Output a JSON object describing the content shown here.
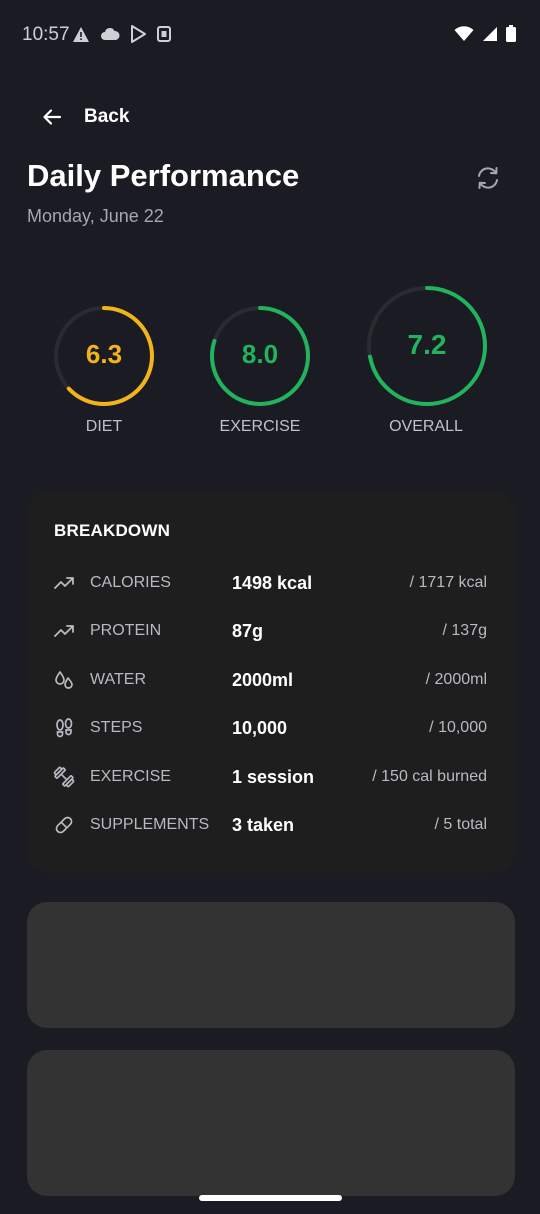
{
  "status_bar": {
    "time": "10:57",
    "left_icons": [
      "warning-icon",
      "cloud-icon",
      "play-store-icon",
      "notification-icon"
    ],
    "right_icons": [
      "wifi-icon",
      "signal-icon",
      "battery-icon"
    ]
  },
  "header": {
    "back_label": "Back",
    "title": "Daily Performance",
    "date": "Monday, June 22"
  },
  "scores": [
    {
      "label": "DIET",
      "value": "6.3",
      "score": 6.3,
      "max": 10,
      "color": "#f2b418"
    },
    {
      "label": "EXERCISE",
      "value": "8.0",
      "score": 8.0,
      "max": 10,
      "color": "#22b35c"
    },
    {
      "label": "OVERALL",
      "value": "7.2",
      "score": 7.2,
      "max": 10,
      "color": "#22b35c"
    }
  ],
  "breakdown": {
    "title": "BREAKDOWN",
    "rows": [
      {
        "icon": "trending-up-icon",
        "label": "CALORIES",
        "value": "1498 kcal",
        "target": "/ 1717 kcal"
      },
      {
        "icon": "trending-up-icon",
        "label": "PROTEIN",
        "value": "87g",
        "target": "/ 137g"
      },
      {
        "icon": "water-drops-icon",
        "label": "WATER",
        "value": "2000ml",
        "target": "/ 2000ml"
      },
      {
        "icon": "footprints-icon",
        "label": "STEPS",
        "value": "10,000",
        "target": "/ 10,000"
      },
      {
        "icon": "dumbbell-icon",
        "label": "EXERCISE",
        "value": "1 session",
        "target": "/ 150 cal burned"
      },
      {
        "icon": "pill-icon",
        "label": "SUPPLEMENTS",
        "value": "3 taken",
        "target": "/ 5 total"
      }
    ]
  },
  "colors": {
    "background": "#1b1b24",
    "card": "#1e1e1e",
    "placeholder": "#333333",
    "diet": "#f2b418",
    "exercise": "#22b35c",
    "track": "#2a2a30"
  }
}
